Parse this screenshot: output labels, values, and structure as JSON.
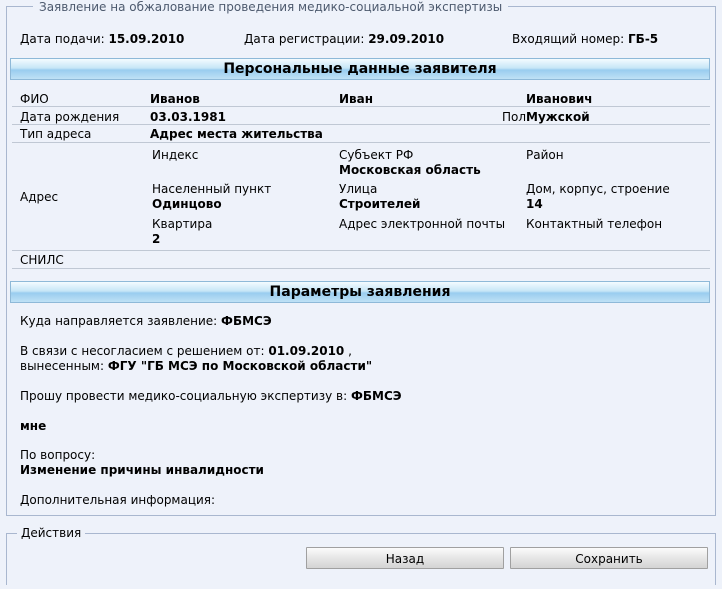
{
  "legend_title": "Заявление на обжалование проведения медико-социальной экспертизы",
  "top": {
    "submit_date_label": "Дата подачи:",
    "submit_date": "15.09.2010",
    "reg_date_label": "Дата регистрации:",
    "reg_date": "29.09.2010",
    "incoming_label": "Входящий номер:",
    "incoming": "ГБ-5"
  },
  "personal": {
    "header": "Персональные данные заявителя",
    "fio_label": "ФИО",
    "last_name": "Иванов",
    "first_name": "Иван",
    "middle_name": "Иванович",
    "dob_label": "Дата рождения",
    "dob": "03.03.1981",
    "sex_label": "Пол",
    "sex": "Мужской",
    "address_type_label": "Тип адреса",
    "address_type": "Адрес места жительства",
    "address_label": "Адрес",
    "index_label": "Индекс",
    "index_value": "",
    "region_label": "Субъект РФ",
    "region": "Московская область",
    "district_label": "Район",
    "district": "",
    "locality_label": "Населенный пункт",
    "locality": "Одинцово",
    "street_label": "Улица",
    "street": "Строителей",
    "house_label": "Дом, корпус, строение",
    "house": "14",
    "flat_label": "Квартира",
    "flat": "2",
    "email_label": "Адрес электронной почты",
    "email": "",
    "phone_label": "Контактный телефон",
    "phone": "",
    "snils_label": "СНИЛС",
    "snils": ""
  },
  "params": {
    "header": "Параметры заявления",
    "dest_label": "Куда направляется заявление:",
    "dest": "ФБМСЭ",
    "disagree_label": "В связи с несогласием с решением от:",
    "disagree_date": "01.09.2010",
    "comma": ",",
    "issued_label": "вынесенным:",
    "issued_by": "ФГУ \"ГБ МСЭ по Московской области\"",
    "conduct_label": "Прошу провести медико-социальную экспертизу в:",
    "conduct": "ФБМСЭ",
    "whom": "мне",
    "question_label": "По вопросу:",
    "question": "Изменение причины инвалидности",
    "extra_label": "Дополнительная информация:"
  },
  "actions": {
    "legend": "Действия",
    "back": "Назад",
    "save": "Сохранить"
  }
}
